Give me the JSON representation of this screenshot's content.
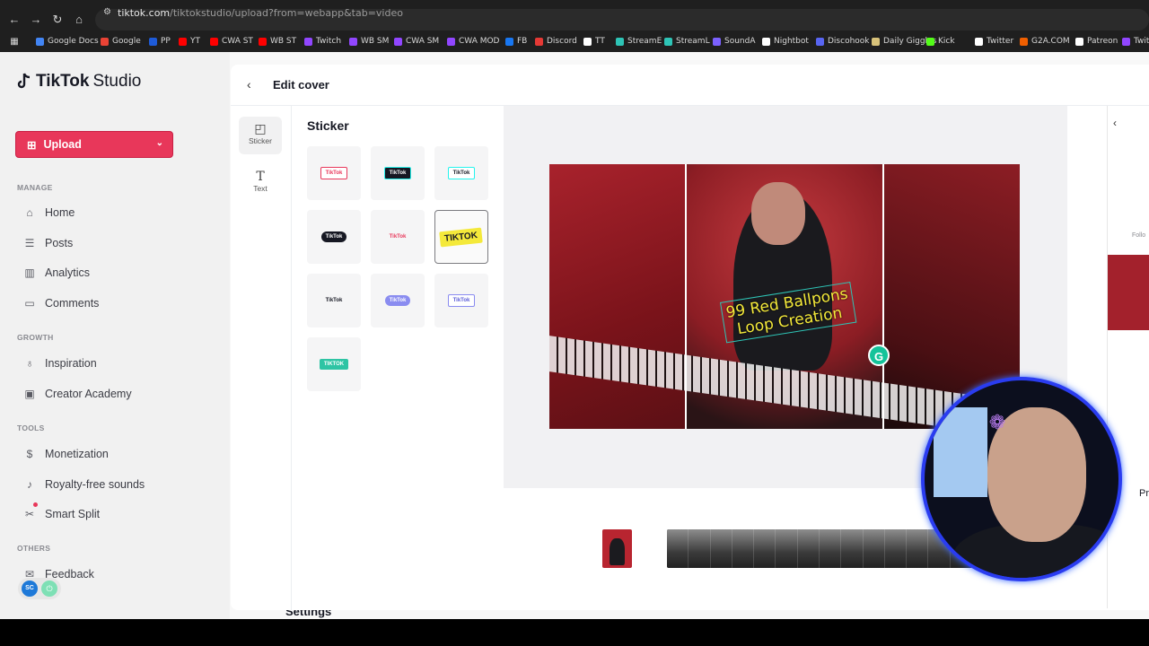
{
  "browser": {
    "url_host": "tiktok.com",
    "url_path": "/tiktokstudio/upload?from=webapp&tab=video",
    "bookmarks": [
      {
        "label": "Google Docs",
        "color": "#4285f4"
      },
      {
        "label": "Google",
        "color": "#ea4335"
      },
      {
        "label": "PP",
        "color": "#1e5bd8"
      },
      {
        "label": "YT",
        "color": "#ff0000"
      },
      {
        "label": "CWA ST",
        "color": "#ff0000"
      },
      {
        "label": "WB ST",
        "color": "#ff0000"
      },
      {
        "label": "Twitch",
        "color": "#9146ff"
      },
      {
        "label": "WB SM",
        "color": "#9146ff"
      },
      {
        "label": "CWA SM",
        "color": "#9146ff"
      },
      {
        "label": "CWA MOD",
        "color": "#9146ff"
      },
      {
        "label": "FB",
        "color": "#1877f2"
      },
      {
        "label": "Discord",
        "color": "#e53935"
      },
      {
        "label": "TT",
        "color": "#ffffff"
      },
      {
        "label": "StreamE",
        "color": "#2ec4b6"
      },
      {
        "label": "StreamL",
        "color": "#2ec4b6"
      },
      {
        "label": "SoundA",
        "color": "#7b61ff"
      },
      {
        "label": "Nightbot",
        "color": "#ffffff"
      },
      {
        "label": "Discohook",
        "color": "#5865f2"
      },
      {
        "label": "Daily Giggles",
        "color": "#d8c27a"
      },
      {
        "label": "Kick",
        "color": "#53fc18"
      },
      {
        "label": "Twitter",
        "color": "#ffffff"
      },
      {
        "label": "G2A.COM",
        "color": "#f05f00"
      },
      {
        "label": "Patreon",
        "color": "#ffffff"
      },
      {
        "label": "Twit",
        "color": "#9146ff"
      }
    ]
  },
  "sidebar": {
    "logo_brand": "TikTok",
    "logo_product": "Studio",
    "upload_label": "Upload",
    "sections": {
      "manage": "MANAGE",
      "growth": "GROWTH",
      "tools": "TOOLS",
      "others": "OTHERS"
    },
    "items": {
      "home": "Home",
      "posts": "Posts",
      "analytics": "Analytics",
      "comments": "Comments",
      "inspiration": "Inspiration",
      "creator_academy": "Creator Academy",
      "monetization": "Monetization",
      "royalty_free": "Royalty-free sounds",
      "smart_split": "Smart Split",
      "feedback": "Feedback"
    },
    "settings_label": "Settings"
  },
  "modal": {
    "title": "Edit cover",
    "rail": {
      "sticker": "Sticker",
      "text": "Text"
    },
    "panel_title": "Sticker",
    "stickers": [
      {
        "name": "tiktok-pink-outline",
        "label": "TikTok"
      },
      {
        "name": "tiktok-dark-box",
        "label": "TikTok"
      },
      {
        "name": "tiktok-white-box",
        "label": "TikTok"
      },
      {
        "name": "tiktok-black-pill",
        "label": "TikTok"
      },
      {
        "name": "tiktok-red-script",
        "label": "TikTok"
      },
      {
        "name": "tiktok-yellow-bold",
        "label": "TIKTOK"
      },
      {
        "name": "tiktok-logo-stacked",
        "label": "TikTok"
      },
      {
        "name": "tiktok-purple-bubble",
        "label": "TikTok"
      },
      {
        "name": "tiktok-window",
        "label": "TikTok"
      },
      {
        "name": "tiktok-green-speech",
        "label": "TIKTOK"
      }
    ],
    "overlay_text_line1": "99 Red Ballpons",
    "overlay_text_line2": "Loop Creation",
    "grammarly_badge": "G"
  },
  "right_panel": {
    "follow_text": "Follo",
    "pr_text": "Pr"
  },
  "widget": {
    "left": "SC",
    "right": "⏻"
  },
  "colors": {
    "accent": "#e8375a",
    "canvas_red": "#8c1d24",
    "overlay_yellow": "#f4e93a",
    "webcam_ring": "#2a3cf0"
  }
}
